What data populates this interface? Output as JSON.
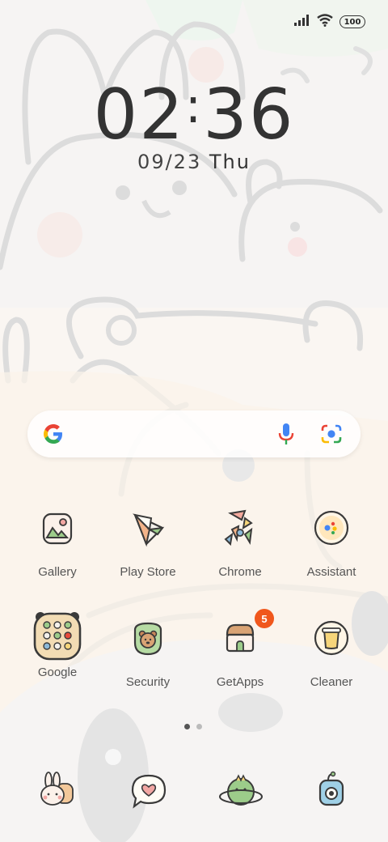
{
  "status_bar": {
    "signal_icon": "signal-bars-icon",
    "wifi_icon": "wifi-icon",
    "battery_level": "100"
  },
  "lock_clock": {
    "hours": "02",
    "separator": ":",
    "minutes": "36",
    "date": "09/23",
    "weekday": "Thu"
  },
  "search_bar": {
    "logo": "google-g-icon",
    "voice_icon": "microphone-icon",
    "lens_icon": "google-lens-icon"
  },
  "apps": [
    {
      "label": "Gallery",
      "icon": "gallery-icon"
    },
    {
      "label": "Play Store",
      "icon": "play-store-icon"
    },
    {
      "label": "Chrome",
      "icon": "chrome-icon"
    },
    {
      "label": "Assistant",
      "icon": "assistant-icon"
    },
    {
      "label": "Google",
      "icon": "google-folder-icon"
    },
    {
      "label": "Security",
      "icon": "security-icon"
    },
    {
      "label": "GetApps",
      "icon": "getapps-icon",
      "badge": "5"
    },
    {
      "label": "Cleaner",
      "icon": "cleaner-icon"
    }
  ],
  "page_indicator": {
    "pages": 2,
    "current": 1
  },
  "dock": [
    {
      "icon": "bunny-app-icon"
    },
    {
      "icon": "messages-heart-icon"
    },
    {
      "icon": "planet-app-icon"
    },
    {
      "icon": "camera-app-icon"
    }
  ],
  "colors": {
    "accent_badge": "#f0571c",
    "text": "#555555",
    "clock": "#333333"
  }
}
